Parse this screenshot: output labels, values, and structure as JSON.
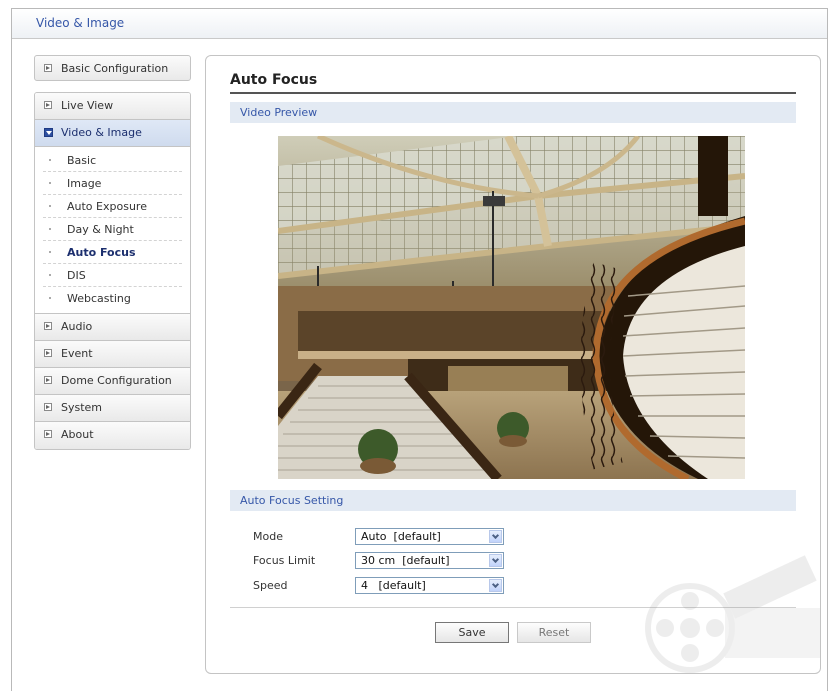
{
  "window": {
    "title": "Video & Image"
  },
  "sidebar": {
    "top_item": "Basic Configuration",
    "items_before": [
      "Live View"
    ],
    "active_group": "Video & Image",
    "submenu": [
      "Basic",
      "Image",
      "Auto Exposure",
      "Day & Night",
      "Auto Focus",
      "DIS",
      "Webcasting"
    ],
    "current_submenu": "Auto Focus",
    "items_after": [
      "Audio",
      "Event",
      "Dome Configuration",
      "System",
      "About"
    ]
  },
  "main": {
    "title": "Auto Focus",
    "preview_section": "Video Preview",
    "settings_section": "Auto Focus Setting",
    "fields": [
      {
        "label": "Mode",
        "value": "Auto  [default]"
      },
      {
        "label": "Focus Limit",
        "value": "30 cm  [default]"
      },
      {
        "label": "Speed",
        "value": "4   [default]"
      }
    ],
    "save_label": "Save",
    "reset_label": "Reset"
  },
  "icons": {
    "expand": "expand-arrow-icon",
    "collapse": "collapse-arrow-icon",
    "dropdown": "chevron-down-icon"
  },
  "colors": {
    "accent": "#3657a8",
    "section_bg": "#e3eaf3",
    "active_menu_bg": "#d6e1f2"
  }
}
